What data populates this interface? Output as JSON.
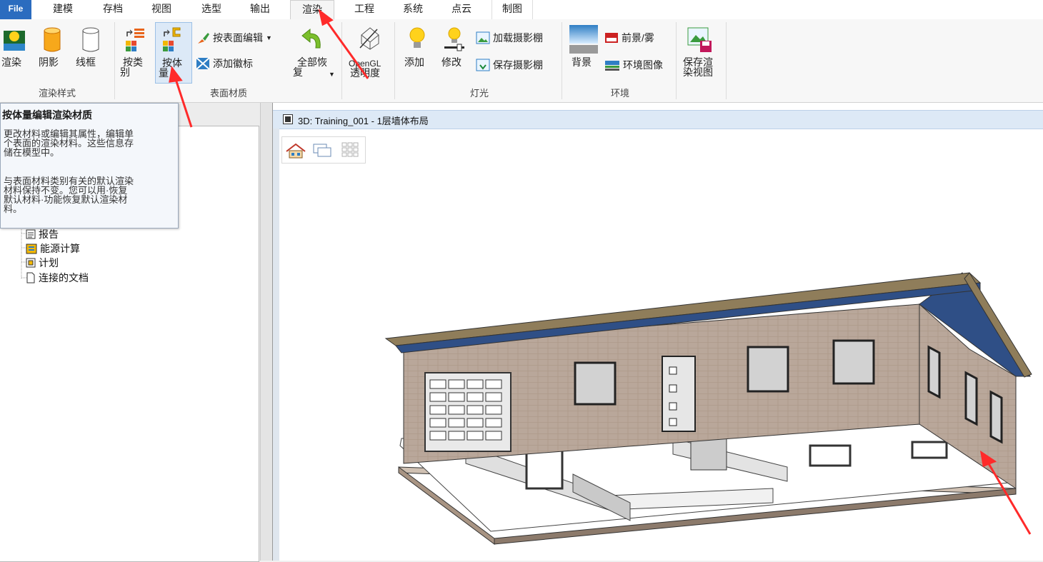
{
  "tabs": [
    {
      "label": "File"
    },
    {
      "label": "建模"
    },
    {
      "label": "存档"
    },
    {
      "label": "视图"
    },
    {
      "label": "选型"
    },
    {
      "label": "输出"
    },
    {
      "label": "渲染"
    },
    {
      "label": "工程"
    },
    {
      "label": "系统"
    },
    {
      "label": "点云"
    },
    {
      "label": "制图"
    }
  ],
  "ribbon": {
    "render_style": {
      "label": "渲染样式",
      "render": "渲染",
      "shadow": "阴影",
      "wireframe": "线框"
    },
    "surface": {
      "label": "表面材质",
      "by_category_1": "按类",
      "by_category_2": "别",
      "by_volume_1": "按体",
      "by_volume_2": "量",
      "edit_by_surface": "按表面编辑",
      "add_badge": "添加徽标",
      "restore_all_1": "全部恢",
      "restore_all_2": "复"
    },
    "opengl": {
      "line1": "OpenGL",
      "line2": "透明度"
    },
    "light": {
      "label": "灯光",
      "add": "添加",
      "modify": "修改",
      "load_studio": "加载摄影棚",
      "save_studio": "保存摄影棚"
    },
    "env": {
      "label": "环境",
      "background": "背景",
      "foreground_fog": "前景/雾",
      "env_image": "环境图像"
    },
    "save": {
      "line1": "保存渲",
      "line2": "染视图"
    }
  },
  "tooltip": {
    "title": "按体量编辑渲染材质",
    "p1_lines": [
      "更改材料或编辑其属性，编辑单",
      "个表面的渲染材料。这些信息存",
      "储在模型中。"
    ],
    "p2_lines": [
      "与表面材料类别有关的默认渲染",
      "材料保持不变。您可以用·恢复",
      "默认材料·功能恢复默认渲染材",
      "料。"
    ]
  },
  "tree": [
    {
      "label": "报告",
      "icon": "report-icon"
    },
    {
      "label": "能源计算",
      "icon": "energy-icon"
    },
    {
      "label": "计划",
      "icon": "plan-icon"
    },
    {
      "label": "连接的文档",
      "icon": "document-icon"
    }
  ],
  "view": {
    "title": "3D: Training_001 - 1层墙体布局"
  },
  "colors": {
    "file_tab": "#2b6cbf",
    "arrow": "#ff2a2a",
    "wall": "#b9a79a",
    "roof": "#2f4f86"
  }
}
